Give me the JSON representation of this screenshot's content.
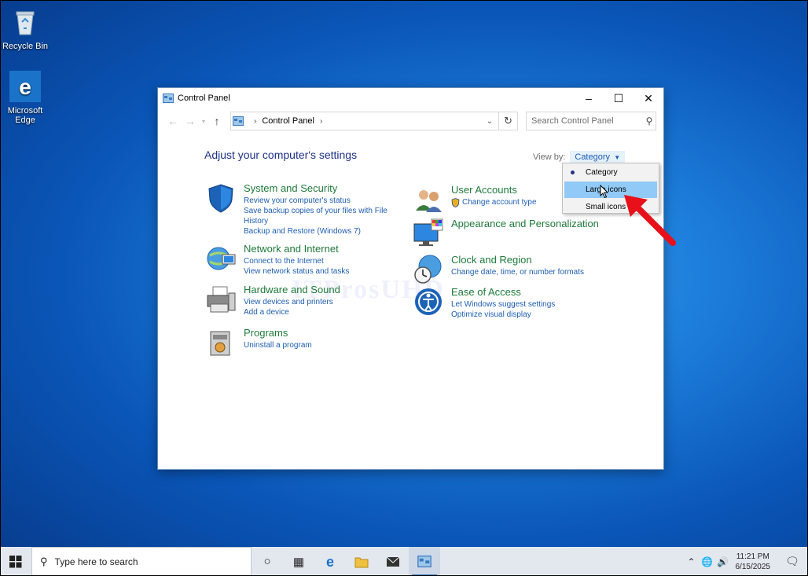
{
  "desktop": {
    "icons": [
      {
        "label": "Recycle Bin",
        "icon": "recycle-bin-icon"
      },
      {
        "label": "Microsoft Edge",
        "icon": "edge-icon"
      }
    ]
  },
  "window": {
    "title": "Control Panel",
    "breadcrumb": [
      "Control Panel"
    ],
    "search_placeholder": "Search Control Panel",
    "heading": "Adjust your computer's settings",
    "view_by_label": "View by:",
    "view_by_value": "Category",
    "watermark": "ITProsUHD"
  },
  "categories": [
    {
      "title": "System and Security",
      "links": [
        "Review your computer's status",
        "Save backup copies of your files with File History",
        "Backup and Restore (Windows 7)"
      ],
      "icon": "shield-icon"
    },
    {
      "title": "Network and Internet",
      "links": [
        "Connect to the Internet",
        "View network status and tasks"
      ],
      "icon": "network-globe-icon"
    },
    {
      "title": "Hardware and Sound",
      "links": [
        "View devices and printers",
        "Add a device"
      ],
      "icon": "printer-icon"
    },
    {
      "title": "Programs",
      "links": [
        "Uninstall a program"
      ],
      "icon": "programs-icon"
    },
    {
      "title": "User Accounts",
      "links": [
        "Change account type"
      ],
      "icon": "users-icon"
    },
    {
      "title": "Appearance and Personalization",
      "links": [],
      "icon": "monitor-palette-icon"
    },
    {
      "title": "Clock and Region",
      "links": [
        "Change date, time, or number formats"
      ],
      "icon": "clock-globe-icon"
    },
    {
      "title": "Ease of Access",
      "links": [
        "Let Windows suggest settings",
        "Optimize visual display"
      ],
      "icon": "ease-of-access-icon"
    }
  ],
  "view_menu": {
    "items": [
      "Category",
      "Large icons",
      "Small icons"
    ],
    "selected": "Category",
    "hovered": "Large icons"
  },
  "taskbar": {
    "search_placeholder": "Type here to search",
    "time": "11:21 PM",
    "date": "6/15/2025"
  },
  "colors": {
    "category_title": "#1f7a3a",
    "link": "#1e5eb0",
    "heading": "#1e3287",
    "menu_hover": "#91c9f7",
    "annotation_arrow": "#e8101a"
  }
}
